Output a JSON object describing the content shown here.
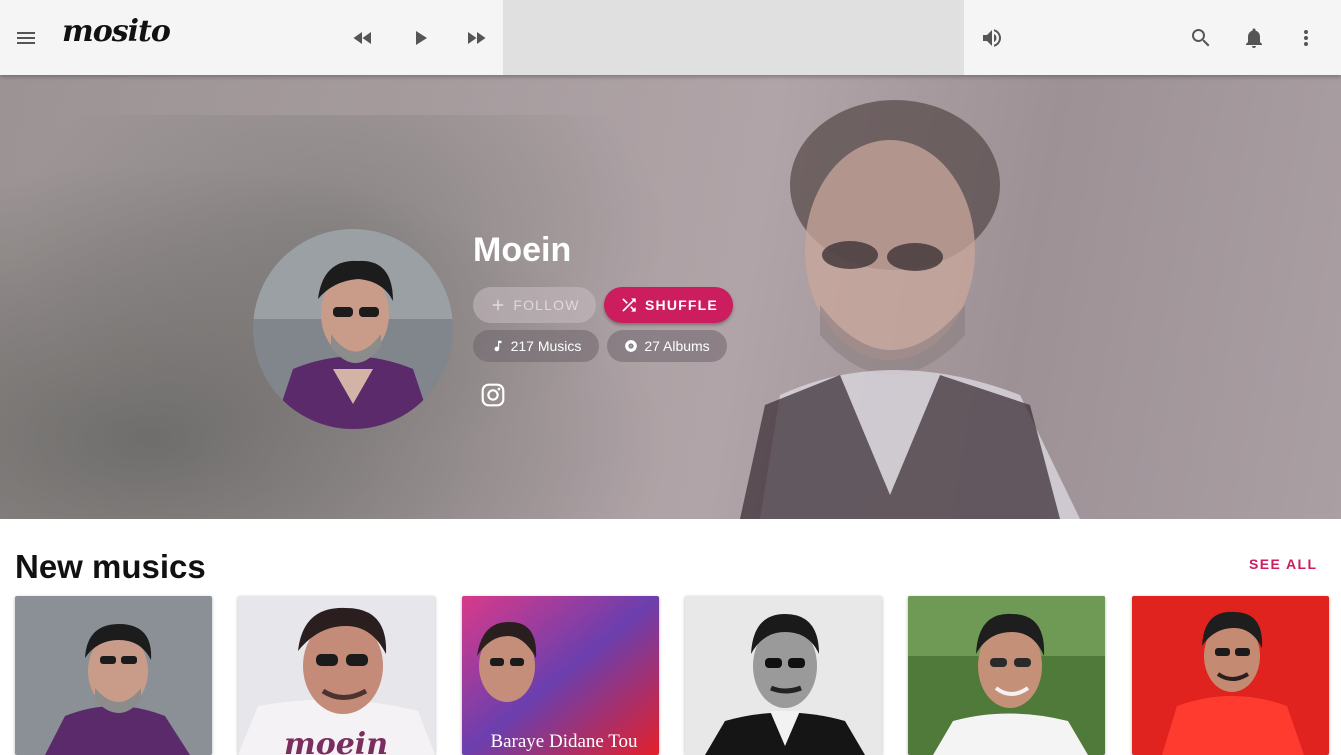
{
  "app": {
    "logo": "mosito"
  },
  "topbar": {
    "icons": [
      "menu-icon",
      "rewind-icon",
      "play-icon",
      "fast-forward-icon",
      "volume-icon",
      "search-icon",
      "bell-icon",
      "more-vert-icon"
    ]
  },
  "artist": {
    "name": "Moein",
    "follow_label": "FOLLOW",
    "shuffle_label": "SHUFFLE",
    "musics_count": "217 Musics",
    "albums_count": "27 Albums"
  },
  "new_musics": {
    "title": "New musics",
    "see_all_label": "SEE ALL",
    "cards": [
      {
        "caption": ""
      },
      {
        "caption": "moein"
      },
      {
        "caption": "Baraye Didane Tou"
      },
      {
        "caption": ""
      },
      {
        "caption": ""
      },
      {
        "caption": ""
      }
    ]
  },
  "colors": {
    "accent": "#cc1d5f",
    "topbar_bg": "#f5f5f5",
    "player_bg": "#e0e0e0"
  }
}
